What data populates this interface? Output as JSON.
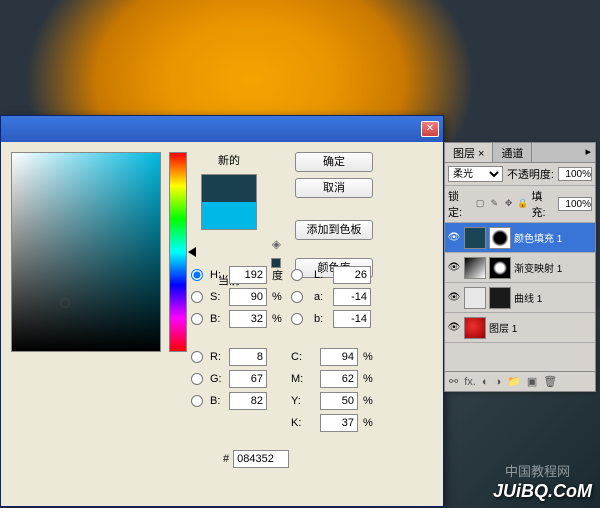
{
  "dialog": {
    "labels": {
      "new": "新的",
      "current": "当前"
    },
    "buttons": {
      "ok": "确定",
      "cancel": "取消",
      "add_swatch": "添加到色板",
      "color_lib": "颜色库"
    },
    "fields": {
      "h": {
        "label": "H:",
        "value": "192",
        "unit": "度"
      },
      "s": {
        "label": "S:",
        "value": "90",
        "unit": "%"
      },
      "b": {
        "label": "B:",
        "value": "32",
        "unit": "%"
      },
      "l": {
        "label": "L:",
        "value": "26"
      },
      "a": {
        "label": "a:",
        "value": "-14"
      },
      "lb": {
        "label": "b:",
        "value": "-14"
      },
      "r": {
        "label": "R:",
        "value": "8"
      },
      "g": {
        "label": "G:",
        "value": "67"
      },
      "bb": {
        "label": "B:",
        "value": "82"
      },
      "c": {
        "label": "C:",
        "value": "94",
        "unit": "%"
      },
      "m": {
        "label": "M:",
        "value": "62",
        "unit": "%"
      },
      "y": {
        "label": "Y:",
        "value": "50",
        "unit": "%"
      },
      "k": {
        "label": "K:",
        "value": "37",
        "unit": "%"
      },
      "hex": {
        "label": "#",
        "value": "084352"
      }
    }
  },
  "layers": {
    "tabs": {
      "layers": "图层 ×",
      "channels": "通道"
    },
    "blend": {
      "mode": "柔光",
      "opacity_label": "不透明度:",
      "opacity": "100%",
      "lock_label": "锁定:",
      "fill_label": "填充:",
      "fill": "100%"
    },
    "items": [
      {
        "name": "颜色填充 1"
      },
      {
        "name": "渐变映射 1"
      },
      {
        "name": "曲线 1"
      },
      {
        "name": "图层 1"
      }
    ]
  },
  "watermarks": {
    "cn": "中国教程网",
    "en": "JUiBQ.CoM"
  }
}
